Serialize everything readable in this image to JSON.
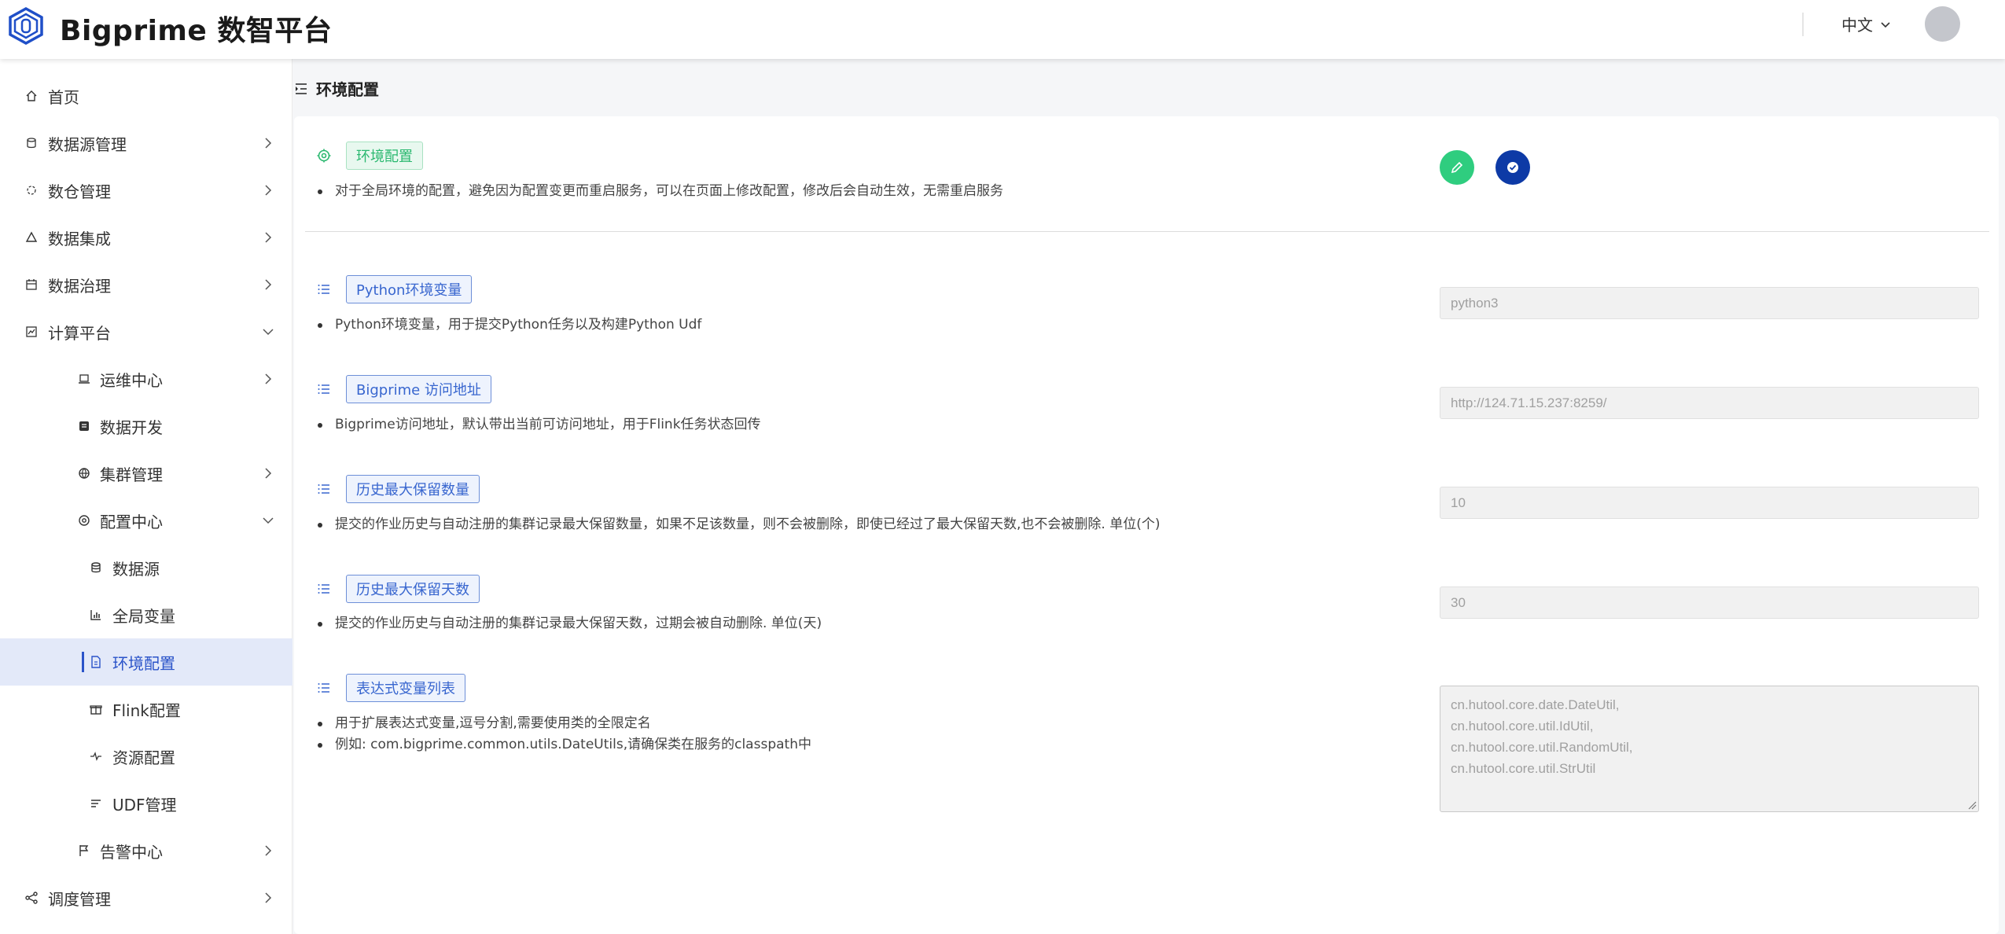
{
  "header": {
    "brand": "Bigprime 数智平台",
    "language": "中文"
  },
  "sidebar": {
    "items": [
      {
        "label": "首页"
      },
      {
        "label": "数据源管理"
      },
      {
        "label": "数仓管理"
      },
      {
        "label": "数据集成"
      },
      {
        "label": "数据治理"
      },
      {
        "label": "计算平台"
      },
      {
        "label": "运维中心"
      },
      {
        "label": "数据开发"
      },
      {
        "label": "集群管理"
      },
      {
        "label": "配置中心"
      },
      {
        "label": "数据源"
      },
      {
        "label": "全局变量"
      },
      {
        "label": "环境配置"
      },
      {
        "label": "Flink配置"
      },
      {
        "label": "资源配置"
      },
      {
        "label": "UDF管理"
      },
      {
        "label": "告警中心"
      },
      {
        "label": "调度管理"
      }
    ]
  },
  "breadcrumb": "环境配置",
  "config": {
    "title": "环境配置",
    "description": "对于全局环境的配置，避免因为配置变更而重启服务，可以在页面上修改配置，修改后会自动生效，无需重启服务",
    "sections": [
      {
        "title": "Python环境变量",
        "descriptions": [
          "Python环境变量，用于提交Python任务以及构建Python Udf"
        ],
        "value": "python3"
      },
      {
        "title": "Bigprime 访问地址",
        "descriptions": [
          "Bigprime访问地址，默认带出当前可访问地址，用于Flink任务状态回传"
        ],
        "value": "http://124.71.15.237:8259/"
      },
      {
        "title": "历史最大保留数量",
        "descriptions": [
          "提交的作业历史与自动注册的集群记录最大保留数量，如果不足该数量，则不会被删除，即使已经过了最大保留天数,也不会被删除. 单位(个)"
        ],
        "value": "10"
      },
      {
        "title": "历史最大保留天数",
        "descriptions": [
          "提交的作业历史与自动注册的集群记录最大保留天数，过期会被自动删除. 单位(天)"
        ],
        "value": "30"
      },
      {
        "title": "表达式变量列表",
        "descriptions": [
          "用于扩展表达式变量,逗号分割,需要使用类的全限定名",
          "例如: com.bigprime.common.utils.DateUtils,请确保类在服务的classpath中"
        ],
        "value_lines": [
          "cn.hutool.core.date.DateUtil,",
          "cn.hutool.core.util.IdUtil,",
          "cn.hutool.core.util.RandomUtil,",
          "cn.hutool.core.util.StrUtil"
        ]
      }
    ]
  },
  "colors": {
    "accent": "#2a53c9",
    "edit_button": "#2fcd7f",
    "save_button": "#0d3aa6"
  }
}
